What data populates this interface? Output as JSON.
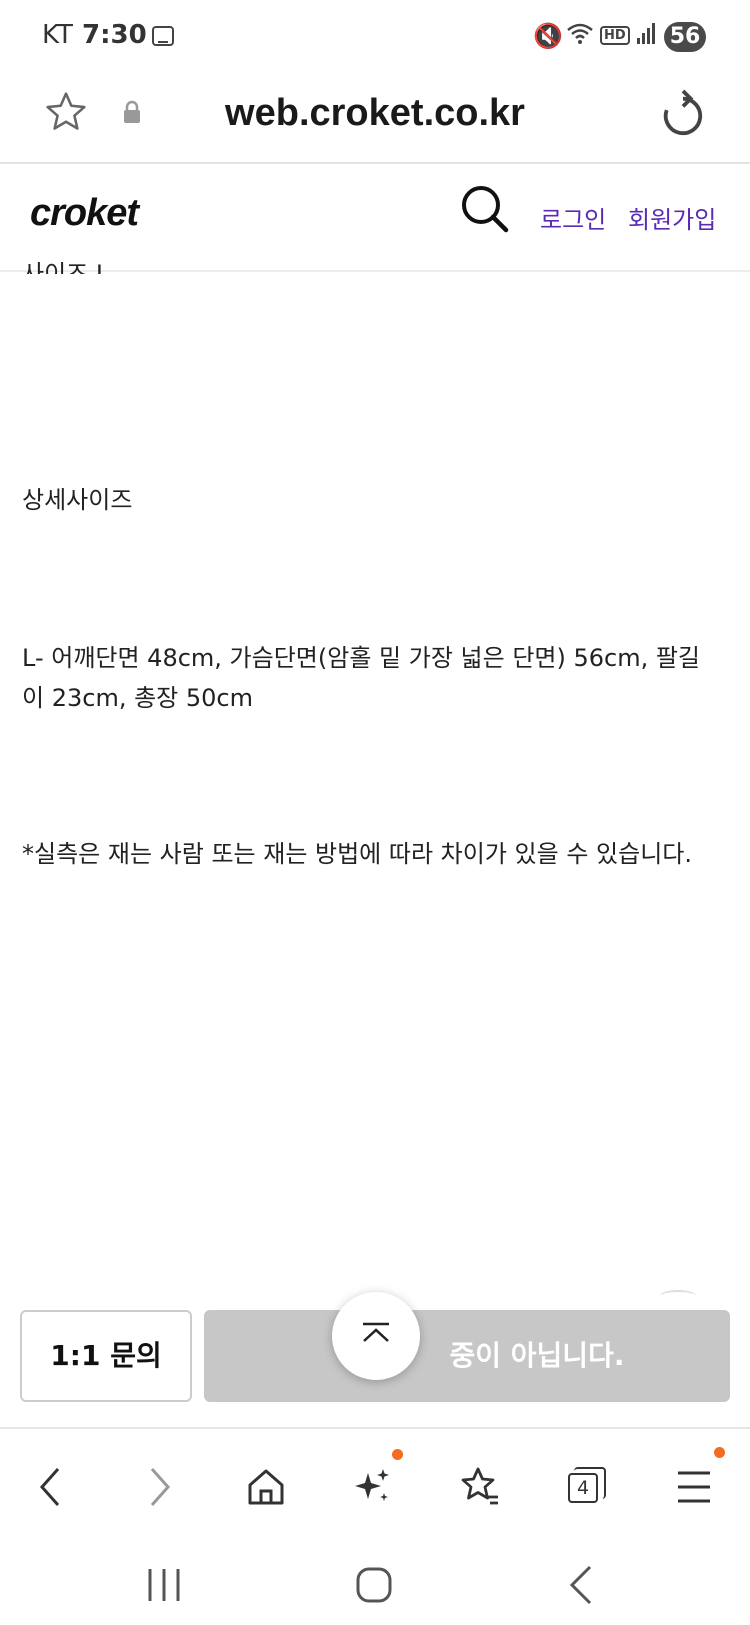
{
  "status_bar": {
    "carrier": "KT",
    "time": "7:30",
    "hd": "HD",
    "battery": "56",
    "icons": [
      "gallery-icon",
      "mute-icon",
      "wifi-icon",
      "signal-icon"
    ]
  },
  "browser": {
    "url": "web.croket.co.kr",
    "icons": [
      "bookmark-star-icon",
      "lock-icon",
      "reload-icon"
    ]
  },
  "site_header": {
    "logo": "croket",
    "login": "로그인",
    "signup": "회원가입"
  },
  "content": {
    "cut_text": "사이즈 L",
    "detail_heading": "상세사이즈",
    "size_line_1": "L- 어깨단면 48cm, 가슴단면(암홀 밑 가장 넓은 단면) 56cm, 팔길",
    "size_line_2": "이 23cm, 총장 50cm",
    "note": "*실측은 재는 사람 또는 재는 방법에 따라 차이가 있을 수 있습니다."
  },
  "actions": {
    "inquiry": "1:1 문의",
    "buy_partial": "중이 아닙니다."
  },
  "toolbar": {
    "tab_count": "4",
    "icons": [
      "back-icon",
      "forward-icon",
      "home-icon",
      "sparkle-icon",
      "bookmarks-icon",
      "tabs-icon",
      "menu-icon"
    ]
  },
  "colors": {
    "link": "#5b2bb5",
    "disabled_button": "#c7c7c7",
    "notification_dot": "#f26d21"
  }
}
